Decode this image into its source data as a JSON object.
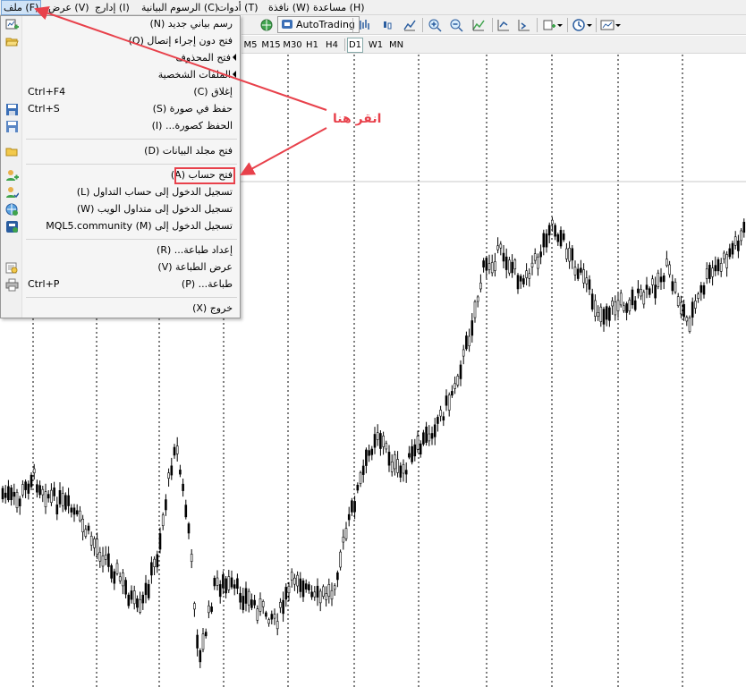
{
  "menubar": {
    "file": "ملف (F)",
    "view": "عرض (V)",
    "insert": "إدارج (I)",
    "charts": "الرسوم البيانية (C)",
    "tools": "أدوات (T)",
    "window": "نافذة (W)",
    "help": "مساعدة (H)"
  },
  "toolbar": {
    "autotrading": "AutoTrading"
  },
  "timeframes": [
    "M5",
    "M15",
    "M30",
    "H1",
    "H4",
    "D1",
    "W1",
    "MN"
  ],
  "timeframe_selected": "D1",
  "menu": {
    "new_chart": "رسم بياني جديد (N)",
    "open_offline": "فتح دون إجراء إتصال (O)",
    "open_deleted": "فتح المحذوف",
    "profiles": "الملفات الشخصية",
    "close": "إغلاق (C)",
    "close_shortcut": "Ctrl+F4",
    "save_as_picture": "حفظ في صورة (S)",
    "save_shortcut": "Ctrl+S",
    "save_picture": "الحفظ كصورة... (I)",
    "open_data_folder": "فتح مجلد البيانات (D)",
    "open_account": "فتح حساب (A)",
    "login_trade": "تسجيل الدخول إلى حساب التداول (L)",
    "login_web": "تسجيل الدخول إلى متداول الويب (W)",
    "login_mql5": "تسجيل الدخول إلى MQL5.community (M)",
    "print_setup": "إعداد طباعة... (R)",
    "print_preview": "عرض الطباعة (V)",
    "print": "طباعة... (P)",
    "print_shortcut": "Ctrl+P",
    "exit": "خروج (X)"
  },
  "annotation": {
    "text": "انقر هنا",
    "color": "#e8414b"
  },
  "colors": {
    "menu_bg": "#f5f5f5",
    "highlight": "#e8414b",
    "candle": "#000000"
  },
  "chart_data": {
    "type": "candlestick",
    "grid_vertical_dotted": true
  }
}
